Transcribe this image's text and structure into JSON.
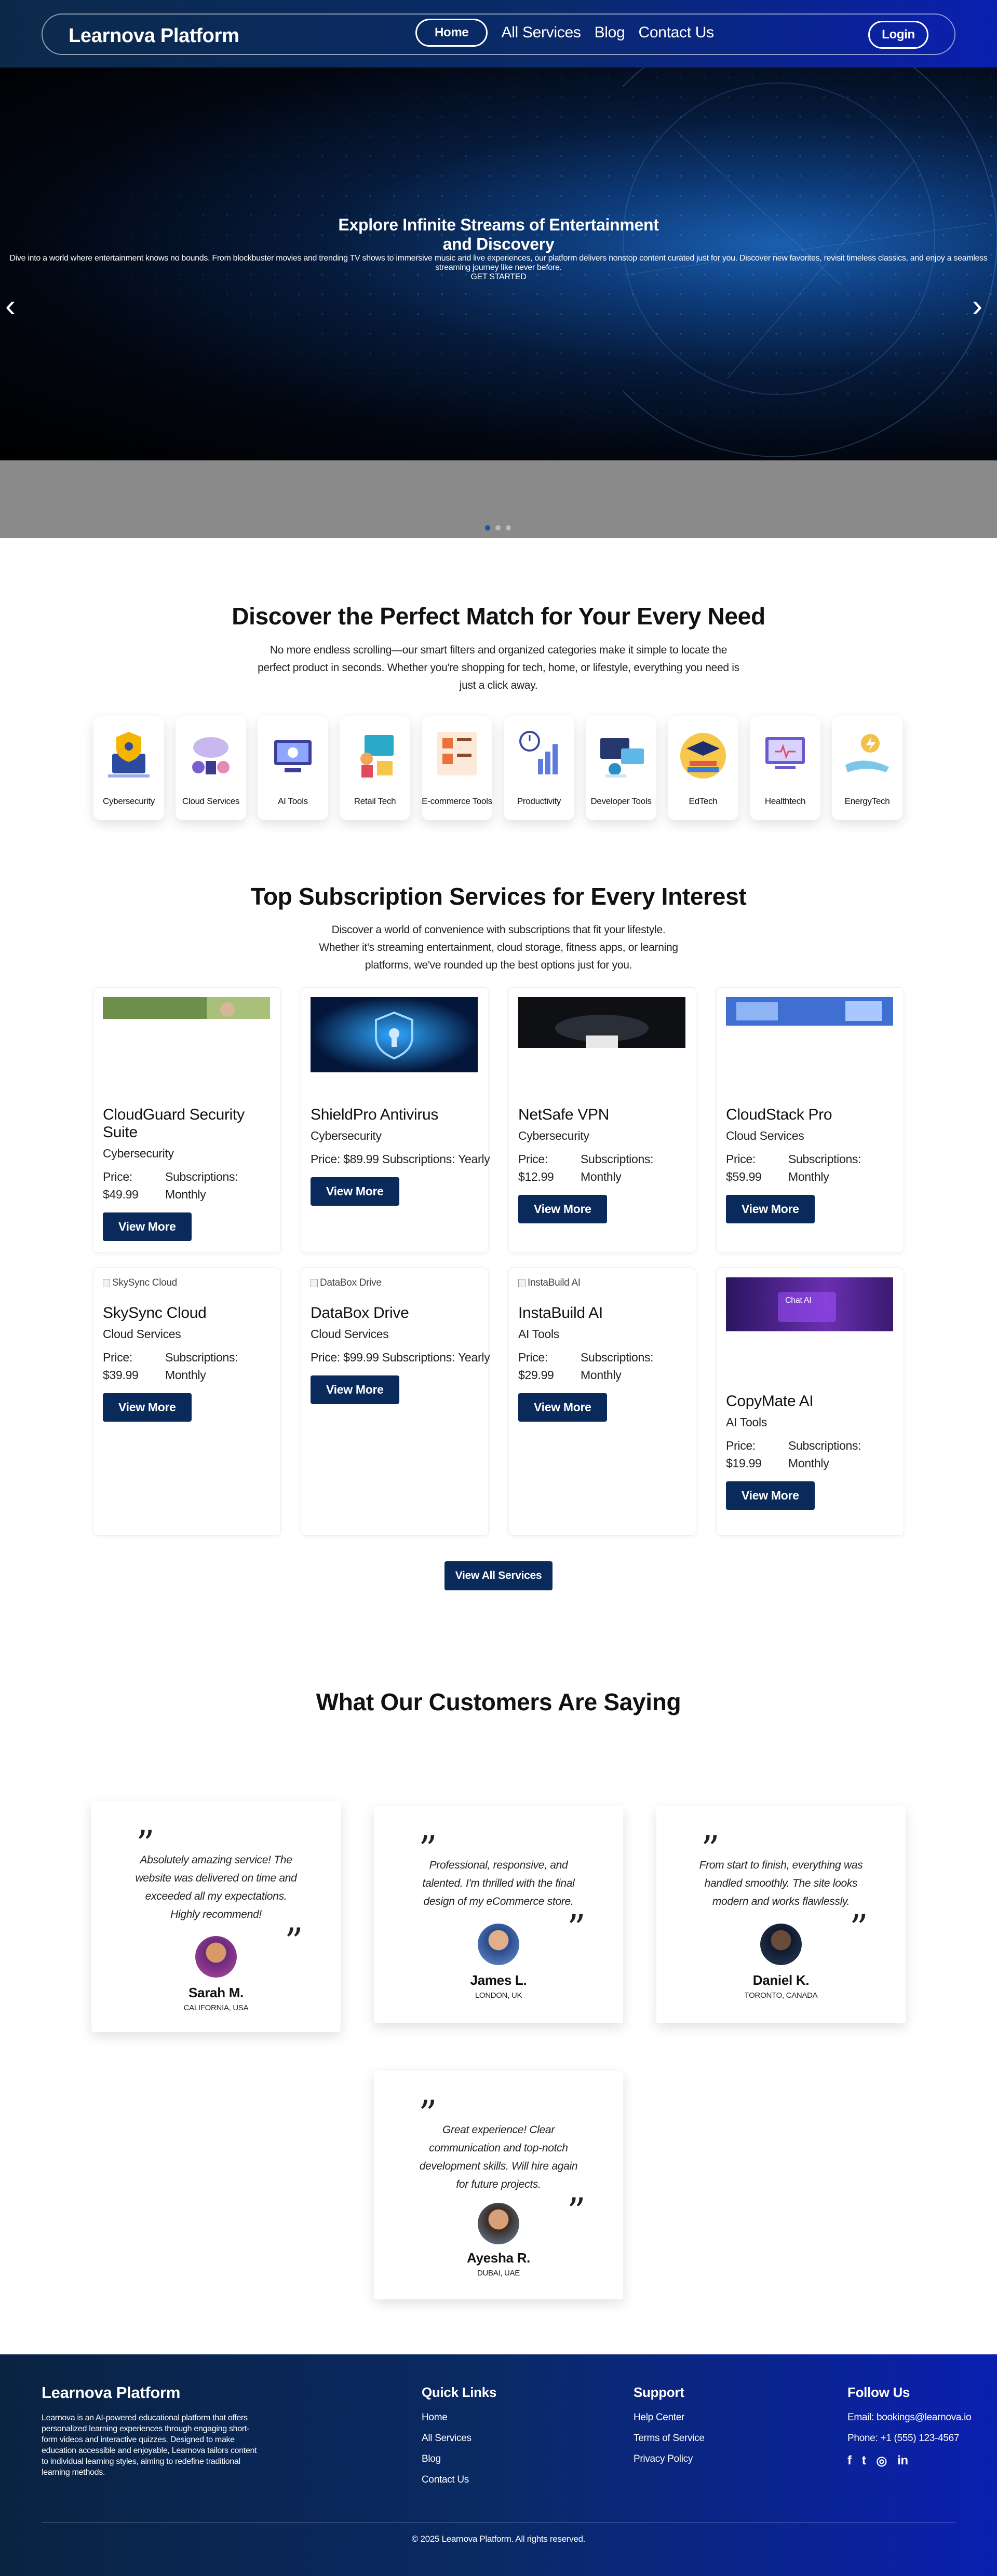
{
  "nav": {
    "brand": "Learnova Platform",
    "links": [
      "Home",
      "All Services",
      "Blog",
      "Contact Us"
    ],
    "login": "Login"
  },
  "hero": {
    "title_line1": "Explore Infinite Streams of Entertainment",
    "title_line2": "and Discovery",
    "description": "Dive into a world where entertainment knows no bounds. From blockbuster movies and trending TV shows to immersive music and live experiences, our platform delivers nonstop content curated just for you. Discover new favorites, revisit timeless classics, and enjoy a seamless streaming journey like never before.",
    "cta": "GET STARTED",
    "prev_icon": "chevron-left-icon",
    "next_icon": "chevron-right-icon"
  },
  "discover": {
    "title": "Discover the Perfect Match for Your Every Need",
    "subtitle": "No more endless scrolling—our smart filters and organized categories make it simple to locate the perfect product in seconds. Whether you're shopping for tech, home, or lifestyle, everything you need is just a click away.",
    "categories": [
      "Cybersecurity",
      "Cloud Services",
      "AI Tools",
      "Retail Tech",
      "E-commerce Tools",
      "Productivity",
      "Developer Tools",
      "EdTech",
      "Healthtech",
      "EnergyTech"
    ]
  },
  "services": {
    "title": "Top Subscription Services for Every Interest",
    "subtitle": "Discover a world of convenience with subscriptions that fit your lifestyle. Whether it's streaming entertainment, cloud storage, fitness apps, or learning platforms, we've rounded up the best options just for you.",
    "price_label": "Price:",
    "subs_label": "Subscriptions:",
    "view_more": "View More",
    "view_all": "View All Services",
    "items": [
      {
        "name": "CloudGuard Security Suite",
        "category": "Cybersecurity",
        "price": "$49.99",
        "sub": "Monthly"
      },
      {
        "name": "ShieldPro Antivirus",
        "category": "Cybersecurity",
        "price": "$89.99",
        "sub": "Yearly"
      },
      {
        "name": "NetSafe VPN",
        "category": "Cybersecurity",
        "price": "$12.99",
        "sub": "Monthly"
      },
      {
        "name": "CloudStack Pro",
        "category": "Cloud Services",
        "price": "$59.99",
        "sub": "Monthly"
      },
      {
        "name": "SkySync Cloud",
        "category": "Cloud Services",
        "price": "$39.99",
        "sub": "Monthly",
        "alt": "SkySync Cloud"
      },
      {
        "name": "DataBox Drive",
        "category": "Cloud Services",
        "price": "$99.99",
        "sub": "Yearly",
        "alt": "DataBox Drive"
      },
      {
        "name": "InstaBuild AI",
        "category": "AI Tools",
        "price": "$29.99",
        "sub": "Monthly",
        "alt": "InstaBuild AI"
      },
      {
        "name": "CopyMate AI",
        "category": "AI Tools",
        "price": "$19.99",
        "sub": "Monthly",
        "img_text": "Chat AI"
      }
    ]
  },
  "testimonials": {
    "title": "What Our Customers Are Saying",
    "items": [
      {
        "text": "Absolutely amazing service! The website was delivered on time and exceeded all my expectations. Highly recommend!",
        "name": "Sarah M.",
        "location": "CALIFORNIA, USA"
      },
      {
        "text": "Professional, responsive, and talented. I'm thrilled with the final design of my eCommerce store.",
        "name": "James L.",
        "location": "LONDON, UK"
      },
      {
        "text": "From start to finish, everything was handled smoothly. The site looks modern and works flawlessly.",
        "name": "Daniel K.",
        "location": "TORONTO, CANADA"
      },
      {
        "text": "Great experience! Clear communication and top-notch development skills. Will hire again for future projects.",
        "name": "Ayesha R.",
        "location": "DUBAI, UAE"
      }
    ]
  },
  "footer": {
    "brand": "Learnova Platform",
    "description": "Learnova is an AI-powered educational platform that offers personalized learning experiences through engaging short-form videos and interactive quizzes. Designed to make education accessible and enjoyable, Learnova tailors content to individual learning styles, aiming to redefine traditional learning methods.",
    "quick_links_title": "Quick Links",
    "quick_links": [
      "Home",
      "All Services",
      "Blog",
      "Contact Us"
    ],
    "support_title": "Support",
    "support_links": [
      "Help Center",
      "Terms of Service",
      "Privacy Policy"
    ],
    "follow_title": "Follow Us",
    "email": "Email: bookings@learnova.io",
    "phone": "Phone: +1 (555) 123-4567",
    "social": [
      "facebook-icon",
      "twitter-icon",
      "instagram-icon",
      "linkedin-icon"
    ],
    "copyright": "© 2025 Learnova Platform. All rights reserved."
  }
}
